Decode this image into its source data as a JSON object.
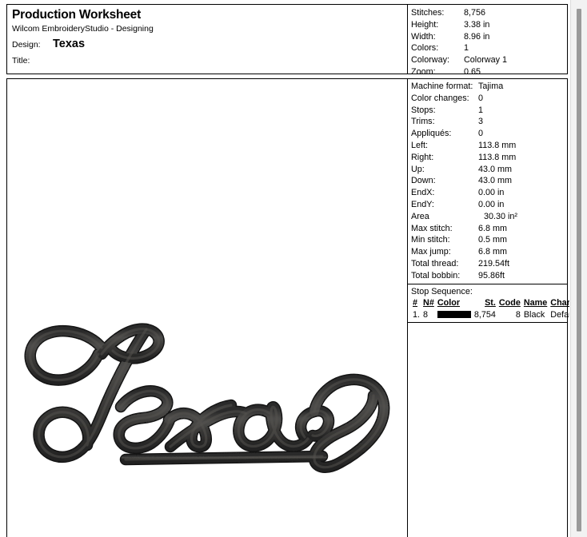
{
  "header": {
    "worksheet_title": "Production Worksheet",
    "software": "Wilcom EmbroideryStudio - Designing",
    "design_label": "Design:",
    "design_name": "Texas",
    "title_label": "Title:",
    "title_value": ""
  },
  "summary": [
    {
      "key": "Stitches:",
      "value": "8,756"
    },
    {
      "key": "Height:",
      "value": "3.38 in"
    },
    {
      "key": "Width:",
      "value": "8.96 in"
    },
    {
      "key": "Colors:",
      "value": "1"
    },
    {
      "key": "Colorway:",
      "value": "Colorway 1"
    },
    {
      "key": "Zoom:",
      "value": "0.65"
    }
  ],
  "details": [
    {
      "key": "Machine format:",
      "value": "Tajima",
      "indent": false
    },
    {
      "key": "Color changes:",
      "value": "0",
      "indent": false
    },
    {
      "key": "Stops:",
      "value": "1",
      "indent": false
    },
    {
      "key": "Trims:",
      "value": "3",
      "indent": false
    },
    {
      "key": "Appliqués:",
      "value": "0",
      "indent": false
    },
    {
      "key": "Left:",
      "value": "113.8 mm",
      "indent": false
    },
    {
      "key": "Right:",
      "value": "113.8 mm",
      "indent": false
    },
    {
      "key": "Up:",
      "value": "43.0 mm",
      "indent": false
    },
    {
      "key": "Down:",
      "value": "43.0 mm",
      "indent": false
    },
    {
      "key": "EndX:",
      "value": "0.00 in",
      "indent": false
    },
    {
      "key": "EndY:",
      "value": "0.00 in",
      "indent": false
    },
    {
      "key": "Area",
      "value": "30.30 in²",
      "indent": true
    },
    {
      "key": "Max stitch:",
      "value": "6.8 mm",
      "indent": false
    },
    {
      "key": "Min stitch:",
      "value": "0.5 mm",
      "indent": false
    },
    {
      "key": "Max jump:",
      "value": "6.8 mm",
      "indent": false
    },
    {
      "key": "Total thread:",
      "value": "219.54ft",
      "indent": false
    },
    {
      "key": "Total bobbin:",
      "value": "95.86ft",
      "indent": false
    }
  ],
  "stop_sequence": {
    "title": "Stop Sequence:",
    "columns": [
      "#",
      "N#",
      "Color",
      "St.",
      "Code",
      "Name",
      "Chart"
    ],
    "rows": [
      {
        "num": "1.",
        "n": "8",
        "color_hex": "#000000",
        "stitches": "8,754",
        "code": "8",
        "name": "Black",
        "chart": "Default"
      }
    ]
  },
  "artwork": {
    "label": "Texas embroidery script design",
    "thread_color": "#3a3a3a",
    "outline_color": "#1a1a1a"
  },
  "scrollbar": {
    "orientation": "vertical"
  }
}
